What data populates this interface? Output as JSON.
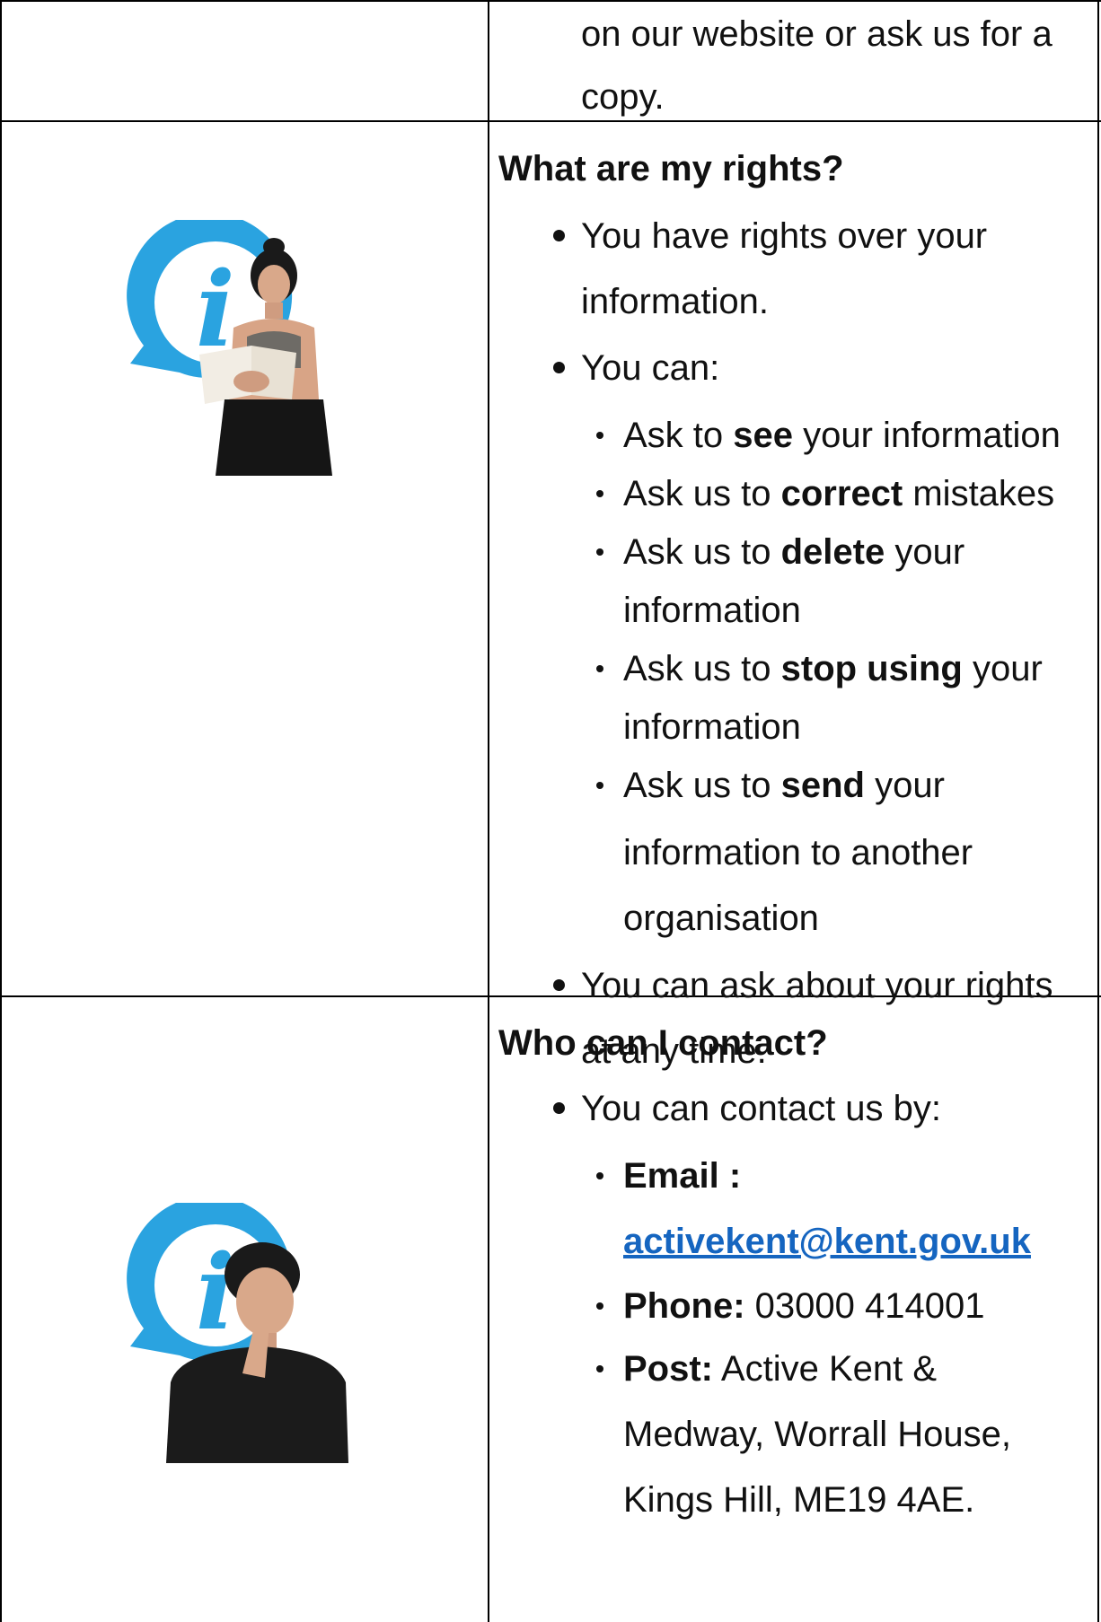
{
  "row1": {
    "lines": [
      "on our website or ask us for a",
      "copy."
    ]
  },
  "rights": {
    "heading": "What are my rights?",
    "bullet1": [
      "You have rights over your",
      "information."
    ],
    "bullet2": "You can:",
    "sub": [
      {
        "pre": "Ask to ",
        "bold": "see",
        "post": " your information"
      },
      {
        "pre": "Ask us to ",
        "bold": "correct",
        "post": " mistakes"
      },
      {
        "pre": "Ask us to ",
        "bold": "delete",
        "post": " your",
        "cont": [
          "information"
        ]
      },
      {
        "pre": "Ask us to ",
        "bold": "stop using",
        "post": " your",
        "cont": [
          "information"
        ]
      },
      {
        "pre": "Ask us to ",
        "bold": "send",
        "post": " your",
        "cont": [
          "information to another",
          "organisation"
        ]
      }
    ],
    "bullet3": [
      "You can ask about your rights",
      "at any time."
    ],
    "illustration": "info-speech-bubble-woman-reading-book"
  },
  "contact": {
    "heading": "Who can I contact?",
    "intro": "You can contact us by:",
    "email_label": "Email :",
    "email": "activekent@kent.gov.uk",
    "phone_label": "Phone:",
    "phone": " 03000 414001",
    "post_label": "Post:",
    "post_lines": [
      " Active Kent &",
      "Medway, Worrall House,",
      "Kings Hill, ME19 4AE."
    ],
    "illustration": "info-speech-bubble-man-thinking"
  },
  "colors": {
    "info_icon": "#2aa3e0",
    "link": "#1565c0"
  }
}
